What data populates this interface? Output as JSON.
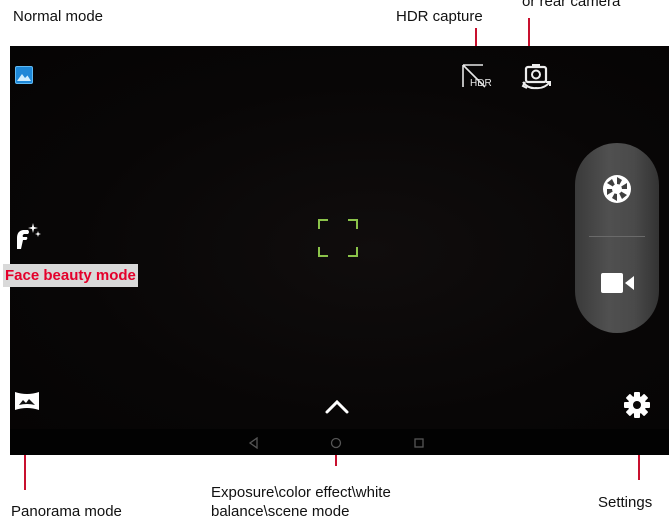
{
  "callouts": {
    "normal_mode": "Normal mode",
    "hdr_capture": "HDR capture",
    "rear_camera": "or rear camera",
    "face_beauty_mode": "Face beauty mode",
    "panorama_mode": "Panorama mode",
    "exposure_line1": "Exposure\\color effect\\white",
    "exposure_line2": "balance\\scene mode",
    "settings": "Settings"
  },
  "camera_ui": {
    "icons": [
      "gallery-icon",
      "hdr-off-icon",
      "switch-camera-icon",
      "face-beauty-icon",
      "focus-frame-icon",
      "shutter-icon",
      "video-record-icon",
      "panorama-icon",
      "chevron-up-icon",
      "settings-gear-icon",
      "nav-back-icon",
      "nav-home-icon",
      "nav-recents-icon"
    ]
  },
  "colors": {
    "leader_line": "#c8102e",
    "face_label_text": "#e4002b",
    "focus_frame": "#8bc34a",
    "gallery_icon": "#3fa9f5",
    "viewfinder_bg": "#080606"
  }
}
